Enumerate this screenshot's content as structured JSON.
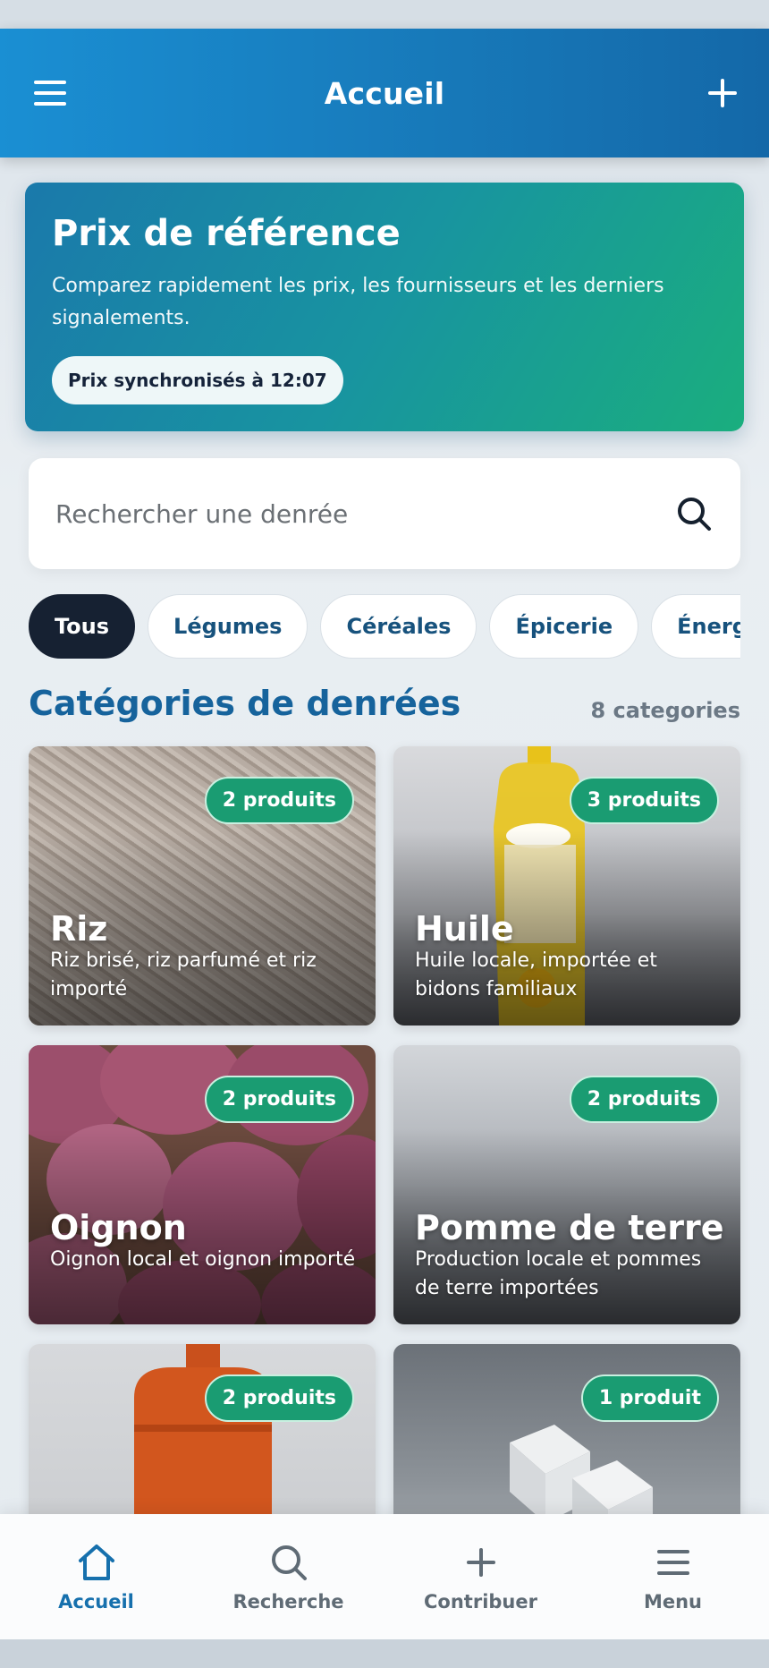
{
  "header": {
    "title": "Accueil"
  },
  "hero": {
    "title": "Prix de référence",
    "subtitle": "Comparez rapidement les prix, les fournisseurs et les derniers signalements.",
    "sync_badge": "Prix synchronisés à 12:07"
  },
  "search": {
    "placeholder": "Rechercher une denrée"
  },
  "filters": [
    {
      "label": "Tous",
      "active": true
    },
    {
      "label": "Légumes",
      "active": false
    },
    {
      "label": "Céréales",
      "active": false
    },
    {
      "label": "Épicerie",
      "active": false
    },
    {
      "label": "Énergie",
      "active": false
    }
  ],
  "section": {
    "title": "Catégories de denrées",
    "count": "8 categories"
  },
  "categories": [
    {
      "name": "Riz",
      "badge": "2 produits",
      "description": "Riz brisé, riz parfumé et riz importé"
    },
    {
      "name": "Huile",
      "badge": "3 produits",
      "description": "Huile locale, importée et bidons familiaux"
    },
    {
      "name": "Oignon",
      "badge": "2 produits",
      "description": "Oignon local et oignon importé"
    },
    {
      "name": "Pomme de terre",
      "badge": "2 produits",
      "description": "Production locale et pommes de terre importées"
    },
    {
      "name": "",
      "badge": "2 produits",
      "description": ""
    },
    {
      "name": "",
      "badge": "1 produit",
      "description": ""
    }
  ],
  "bottom_nav": [
    {
      "label": "Accueil",
      "icon": "home-icon",
      "active": true
    },
    {
      "label": "Recherche",
      "icon": "search-icon",
      "active": false
    },
    {
      "label": "Contribuer",
      "icon": "plus-icon",
      "active": false
    },
    {
      "label": "Menu",
      "icon": "menu-icon",
      "active": false
    }
  ],
  "colors": {
    "appbar": "#1778b8",
    "accent": "#16639c",
    "badge": "#1a9c72",
    "chip_active": "#162132"
  }
}
